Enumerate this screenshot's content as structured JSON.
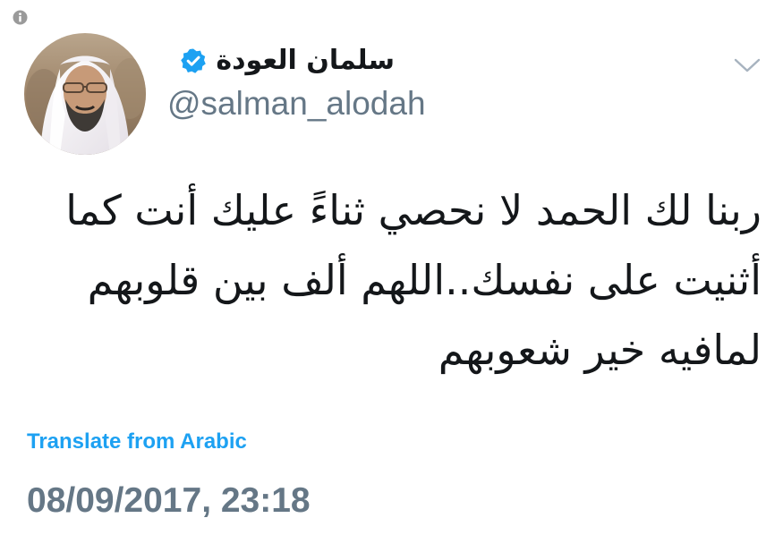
{
  "tweet": {
    "author": {
      "display_name": "سلمان العودة",
      "handle": "@salman_alodah",
      "verified": true
    },
    "text": "ربنا لك الحمد لا نحصي ثناءً عليك أنت كما\nأثنيت على نفسك..اللهم ألف بين قلوبهم\nلمافيه خير شعوبهم",
    "translate_label": "Translate from Arabic",
    "timestamp": "08/09/2017, 23:18"
  },
  "icons": {
    "info": "info-icon",
    "verified": "verified-badge-icon",
    "menu": "chevron-down-icon"
  },
  "colors": {
    "link": "#1da1f2",
    "secondary_text": "#657786",
    "primary_text": "#14171a",
    "verified": "#1da1f2"
  }
}
